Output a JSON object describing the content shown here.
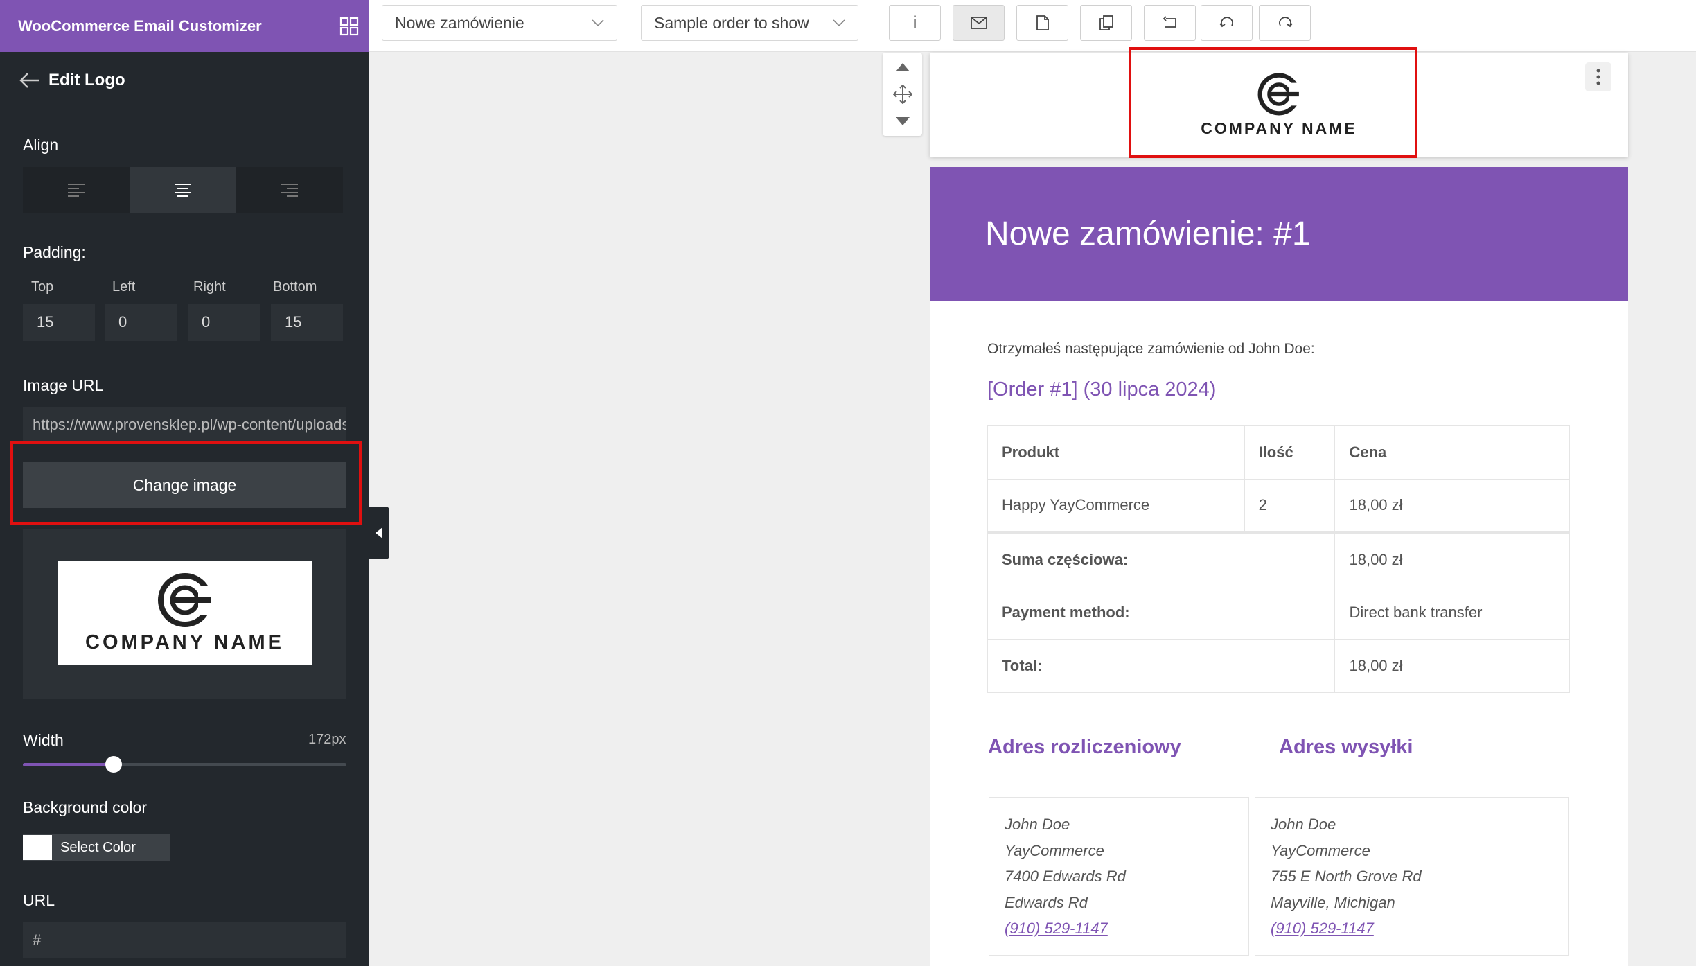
{
  "sidebar": {
    "app_title": "WooCommerce Email Customizer",
    "panel_title": "Edit Logo",
    "align_label": "Align",
    "padding_label": "Padding:",
    "padding": {
      "top_label": "Top",
      "left_label": "Left",
      "right_label": "Right",
      "bottom_label": "Bottom",
      "top": "15",
      "left": "0",
      "right": "0",
      "bottom": "15"
    },
    "image_url_label": "Image URL",
    "image_url": "https://www.provensklep.pl/wp-content/uploads/",
    "change_image_label": "Change image",
    "preview_logo_text": "COMPANY NAME",
    "width_label": "Width",
    "width_value": "172px",
    "width_fraction": 0.28,
    "bg_color_label": "Background color",
    "bg_color": "#ffffff",
    "select_color_label": "Select Color",
    "url_label": "URL",
    "url_value": "#"
  },
  "topbar": {
    "email_type": "Nowe zamówienie",
    "sample_order": "Sample order to show",
    "info_label": "i"
  },
  "email": {
    "logo_text": "COMPANY NAME",
    "heading": "Nowe zamówienie: #1",
    "intro": "Otrzymałeś następujące zamówienie od John Doe:",
    "order_title": "[Order #1] (30 lipca 2024)",
    "table": {
      "headers": [
        "Produkt",
        "Ilość",
        "Cena"
      ],
      "item": {
        "name": "Happy YayCommerce",
        "qty": "2",
        "price": "18,00 zł"
      },
      "subtotal_label": "Suma częściowa:",
      "subtotal": "18,00 zł",
      "payment_label": "Payment method:",
      "payment": "Direct bank transfer",
      "total_label": "Total:",
      "total": "18,00 zł"
    },
    "billing": {
      "title": "Adres rozliczeniowy",
      "name": "John Doe",
      "company": "YayCommerce",
      "street": "7400 Edwards Rd",
      "city": "Edwards Rd",
      "phone": "(910) 529-1147"
    },
    "shipping": {
      "title": "Adres wysyłki",
      "name": "John Doe",
      "company": "YayCommerce",
      "street": "755 E North Grove Rd",
      "city": "Mayville, Michigan",
      "phone": "(910) 529-1147"
    }
  },
  "colors": {
    "accent": "#7f54b3",
    "sidebar_bg": "#23282d",
    "highlight": "#e01010"
  }
}
